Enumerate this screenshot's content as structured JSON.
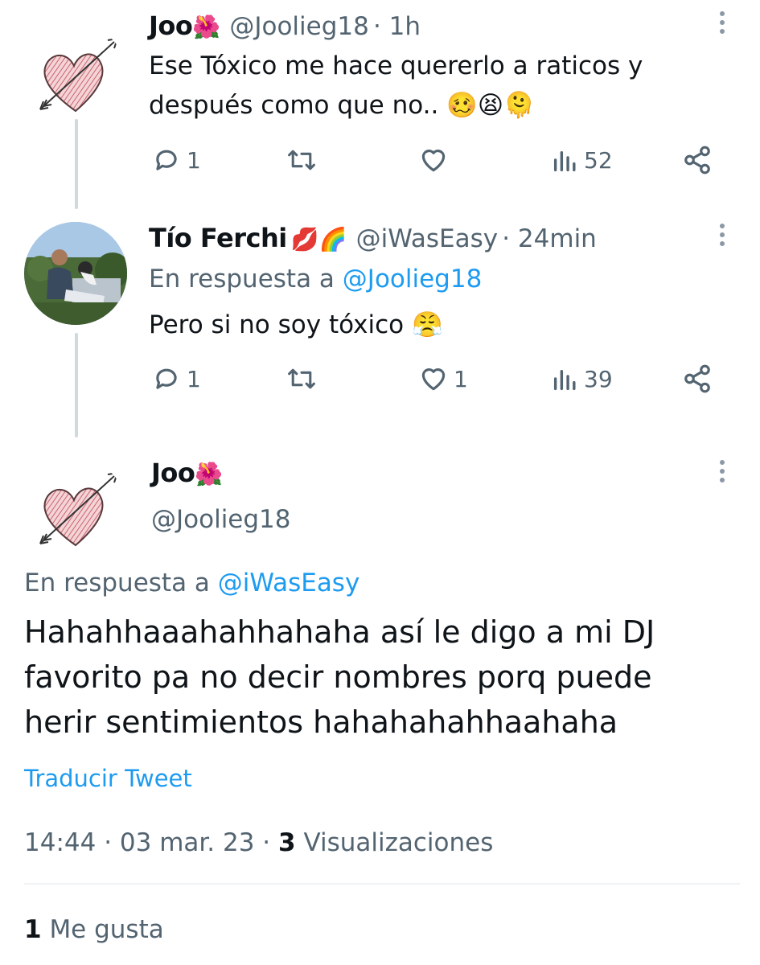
{
  "tweets": [
    {
      "name": "Joo",
      "name_emoji": "🌺",
      "handle": "@Joolieg18",
      "time": "· 1h",
      "text_line1": "Ese Tóxico me hace quererlo a raticos y",
      "text_line2": "después como que no..",
      "text_emojis": "🥴😫🫠",
      "replies": "1",
      "retweets": "",
      "likes": "",
      "views": "52"
    },
    {
      "name": "Tío Ferchi",
      "name_emoji": "💋🌈",
      "handle": "@iWasEasy",
      "time": "· 24min",
      "reply_prefix": "En respuesta a",
      "reply_to": "@Joolieg18",
      "text": "Pero si no soy tóxico",
      "text_emoji": "😤",
      "replies": "1",
      "retweets": "",
      "likes": "1",
      "views": "39"
    }
  ],
  "main_tweet": {
    "name": "Joo",
    "name_emoji": "🌺",
    "handle": "@Joolieg18",
    "reply_prefix": "En respuesta a",
    "reply_to": "@iWasEasy",
    "text_line1": "Hahahhaaahahhahaha así le digo a mi DJ",
    "text_line2": "favorito pa no decir nombres porq puede",
    "text_line3": "herir sentimientos hahahahahhaahaha",
    "translate": "Traducir Tweet",
    "timestamp": "14:44 · 03 mar. 23 ·",
    "views_count": "3",
    "views_label": "Visualizaciones",
    "likes_count": "1",
    "likes_label": "Me gusta"
  },
  "colors": {
    "accent": "#1d9bf0",
    "muted": "#536471",
    "text": "#0f1419",
    "heart_fill": "#e8a0a6"
  }
}
